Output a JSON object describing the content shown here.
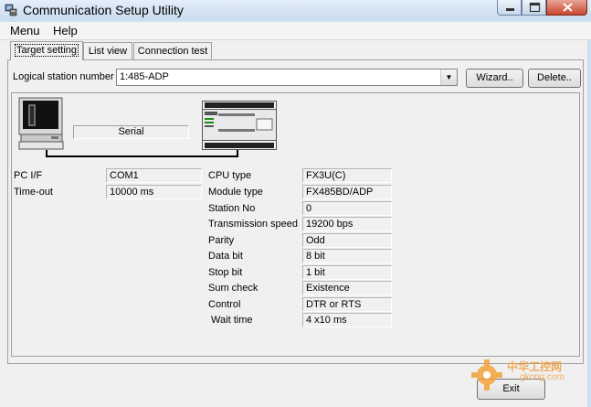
{
  "window": {
    "title": "Communication Setup Utility"
  },
  "menu": {
    "items": [
      "Menu",
      "Help"
    ]
  },
  "tabs": [
    "Target setting",
    "List view",
    "Connection test"
  ],
  "logical_station": {
    "label": "Logical station number",
    "value": "1:485-ADP",
    "wizard_label": "Wizard..",
    "delete_label": "Delete.."
  },
  "diagram": {
    "link_label": "Serial"
  },
  "pc": {
    "rows": [
      {
        "label": "PC I/F",
        "value": "COM1"
      },
      {
        "label": "Time-out",
        "value": "10000 ms"
      }
    ]
  },
  "plc": {
    "rows": [
      {
        "label": "CPU type",
        "value": "FX3U(C)"
      },
      {
        "label": "Module type",
        "value": "FX485BD/ADP"
      },
      {
        "label": "Station No",
        "value": "0"
      },
      {
        "label": "Transmission speed",
        "value": "19200 bps"
      },
      {
        "label": "Parity",
        "value": "Odd"
      },
      {
        "label": "Data bit",
        "value": "8 bit"
      },
      {
        "label": "Stop bit",
        "value": "1 bit"
      },
      {
        "label": "Sum check",
        "value": "Existence"
      },
      {
        "label": "Control",
        "value": "DTR or RTS"
      },
      {
        "label": " Wait time",
        "value": "4 x10 ms"
      }
    ]
  },
  "exit_label": "Exit",
  "watermark": {
    "text": "中华工控网",
    "site": "gkong.com"
  },
  "colors": {
    "title_bg": "#cfe0f0",
    "close": "#c8462f",
    "panel": "#f0f0f0"
  }
}
